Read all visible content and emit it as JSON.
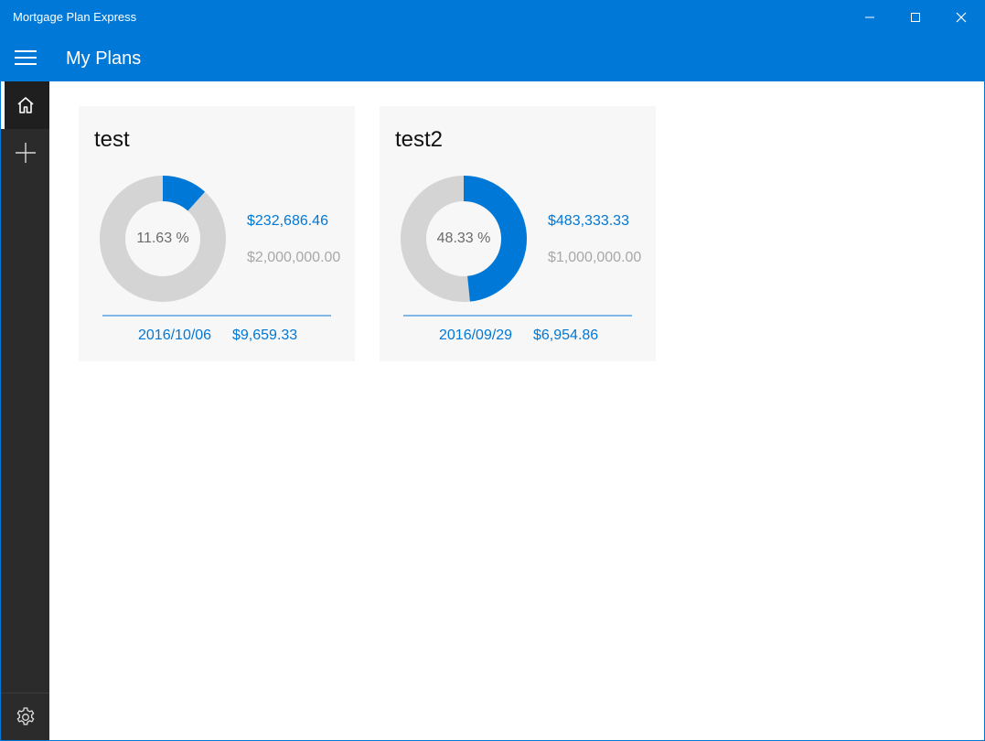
{
  "window": {
    "title": "Mortgage Plan Express"
  },
  "header": {
    "title": "My Plans"
  },
  "sidebar": {
    "items": [
      {
        "icon": "home-icon",
        "active": true
      },
      {
        "icon": "add-icon",
        "active": false
      }
    ],
    "footer_icon": "gear-icon"
  },
  "colors": {
    "accent": "#0078d7",
    "track": "#d4d4d4",
    "card": "#f7f7f7",
    "sidebar": "#2b2b2b"
  },
  "plans": [
    {
      "name": "test",
      "progress_percent": 11.63,
      "progress_label": "11.63 %",
      "amount_paid": "$232,686.46",
      "amount_total": "$2,000,000.00",
      "date": "2016/10/06",
      "payment": "$9,659.33"
    },
    {
      "name": "test2",
      "progress_percent": 48.33,
      "progress_label": "48.33 %",
      "amount_paid": "$483,333.33",
      "amount_total": "$1,000,000.00",
      "date": "2016/09/29",
      "payment": "$6,954.86"
    }
  ]
}
